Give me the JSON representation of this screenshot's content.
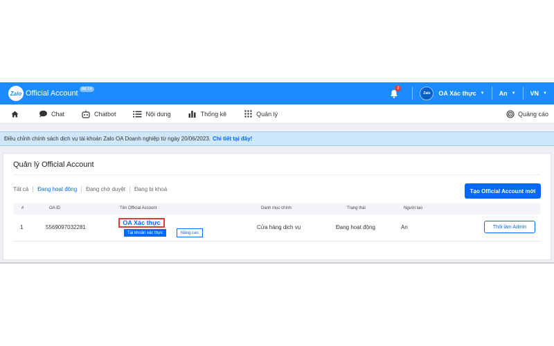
{
  "topbar": {
    "logo_badge": "Zalo",
    "app_title": "Official Account",
    "beta": "BETA",
    "notification_count": "3",
    "oa_avatar": "Zalo",
    "oa_name": "OA Xác thực",
    "user": "An",
    "language": "VN",
    "brand_color": "#1a8cff"
  },
  "nav": {
    "home_icon": "home-icon",
    "items": [
      {
        "label": "Chat",
        "icon": "chat-icon"
      },
      {
        "label": "Chatbot",
        "icon": "robot-icon"
      },
      {
        "label": "Nội dung",
        "icon": "list-icon"
      },
      {
        "label": "Thống kê",
        "icon": "bar-chart-icon"
      },
      {
        "label": "Quản lý",
        "icon": "grid-icon"
      }
    ],
    "ads_label": "Quảng cáo"
  },
  "banner": {
    "text": "Điều chỉnh chính sách dịch vụ tài khoản Zalo OA Doanh nghiệp từ ngày 20/06/2023.",
    "link": "Chi tiết tại đây!"
  },
  "card": {
    "title": "Quản lý Official Account",
    "filters": [
      "Tất cả",
      "Đang hoạt động",
      "Đang chờ duyệt",
      "Đang bị khoá"
    ],
    "active_filter": "Đang hoạt động",
    "create_button": "Tạo Official Account mới",
    "columns": [
      "#",
      "OA ID",
      "Tên Official Account",
      "Danh mục chính",
      "Trạng thái",
      "Người tạo"
    ],
    "row": {
      "index": "1",
      "oa_id": "5569097032281",
      "name": "OA Xác thực",
      "verified_tag": "Tài khoản xác thực",
      "upgrade_tag": "Nâng cao",
      "category": "Cửa hàng dịch vụ",
      "status": "Đang hoạt động",
      "creator": "An",
      "action": "Thôi làm Admin"
    }
  }
}
